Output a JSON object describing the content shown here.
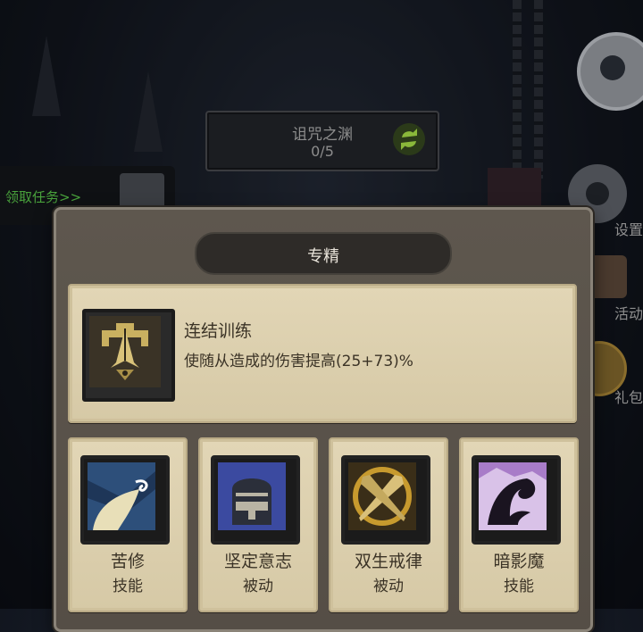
{
  "quest": {
    "title": "诅咒之渊",
    "progress": "0/5"
  },
  "claim_task_label": "领取任务>>",
  "side_menu": {
    "settings_label": "设置",
    "activity_label": "活动",
    "gift_label": "礼包"
  },
  "panel": {
    "title": "专精",
    "specialization": {
      "name": "连结训练",
      "description": "使随从造成的伤害提高(25+73)%",
      "icon": "praying-hands-emblem-icon"
    },
    "skills": [
      {
        "name": "苦修",
        "type": "技能",
        "icon": "monk-robe-icon",
        "color": "#2d4f7a"
      },
      {
        "name": "坚定意志",
        "type": "被动",
        "icon": "knight-helmet-icon",
        "color": "#3b4aa0"
      },
      {
        "name": "双生戒律",
        "type": "被动",
        "icon": "crossed-swords-icon",
        "color": "#6f5a20"
      },
      {
        "name": "暗影魔",
        "type": "技能",
        "icon": "shadowfiend-icon",
        "color": "#5a3a7a"
      }
    ]
  },
  "colors": {
    "panel_bg": "#5e574e",
    "parchment": "#e2d6b6",
    "claim_text": "#49a23c",
    "quest_text": "#8d8d8d"
  }
}
